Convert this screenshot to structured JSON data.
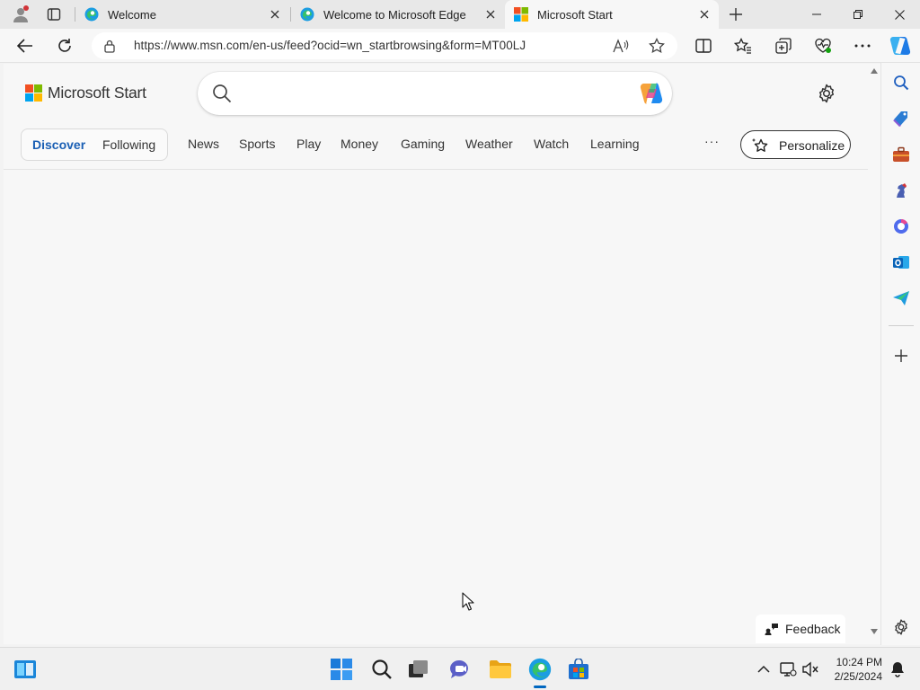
{
  "tabs": [
    {
      "title": "Welcome",
      "icon": "edge-icon",
      "active": false
    },
    {
      "title": "Welcome to Microsoft Edge",
      "icon": "edge-icon",
      "active": false
    },
    {
      "title": "Microsoft Start",
      "icon": "microsoft-logo-icon",
      "active": true
    }
  ],
  "address": {
    "url": "https://www.msn.com/en-us/feed?ocid=wn_startbrowsing&form=MT00LJ"
  },
  "page": {
    "brand": "Microsoft Start",
    "search_placeholder": "",
    "tabs_pill": {
      "discover": "Discover",
      "following": "Following"
    },
    "nav": [
      "News",
      "Sports",
      "Play",
      "Money",
      "Gaming",
      "Weather",
      "Watch",
      "Learning"
    ],
    "more": "···",
    "personalize": "Personalize",
    "feedback": "Feedback"
  },
  "colors": {
    "accent": "#0067c0",
    "discover_text": "#1a5fb4"
  },
  "taskbar": {
    "time": "10:24 PM",
    "date": "2/25/2024"
  }
}
